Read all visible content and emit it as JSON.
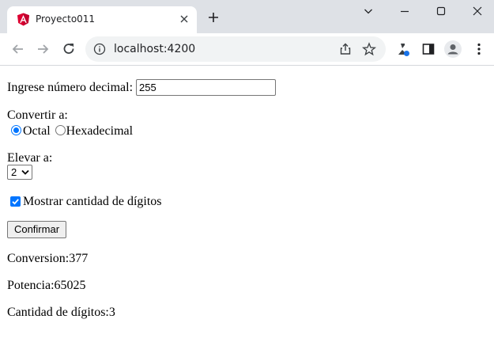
{
  "browser": {
    "tab_title": "Proyecto011",
    "url": "localhost:4200",
    "icons": [
      "angular-icon",
      "close-icon",
      "plus-icon",
      "back-icon",
      "forward-icon",
      "reload-icon",
      "info-icon",
      "share-icon",
      "star-icon",
      "extensions-icon",
      "sidepanel-icon",
      "profile-icon",
      "menu-icon",
      "chevron-down-icon",
      "minimize-icon",
      "maximize-icon",
      "window-close-icon"
    ],
    "accent": "#1a73e8"
  },
  "form": {
    "decimal_label": "Ingrese número decimal:",
    "decimal_value": "255",
    "convert_label": "Convertir a:",
    "option_octal": "Octal",
    "option_hex": "Hexadecimal",
    "selected_option": "Octal",
    "power_label": "Elevar a:",
    "power_value": "2",
    "show_digits_label": "Mostrar cantidad de dígitos",
    "show_digits_checked": true,
    "confirm_label": "Confirmar"
  },
  "results": {
    "conversion": "Conversion:377",
    "power": "Potencia:65025",
    "digits": "Cantidad de dígitos:3"
  }
}
